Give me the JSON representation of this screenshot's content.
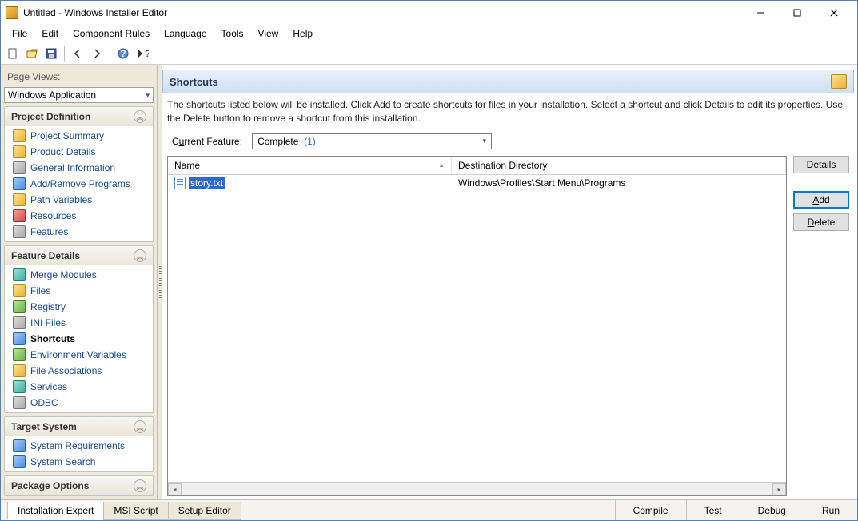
{
  "window": {
    "title": "Untitled - Windows Installer Editor"
  },
  "menu": {
    "file": "File",
    "edit": "Edit",
    "component_rules": "Component Rules",
    "language": "Language",
    "tools": "Tools",
    "view": "View",
    "help": "Help"
  },
  "sidebar": {
    "page_views_label": "Page Views:",
    "page_views_value": "Windows Application",
    "groups": {
      "project_definition": {
        "title": "Project Definition",
        "items": [
          "Project Summary",
          "Product Details",
          "General Information",
          "Add/Remove Programs",
          "Path Variables",
          "Resources",
          "Features"
        ]
      },
      "feature_details": {
        "title": "Feature Details",
        "items": [
          "Merge Modules",
          "Files",
          "Registry",
          "INI Files",
          "Shortcuts",
          "Environment Variables",
          "File Associations",
          "Services",
          "ODBC"
        ]
      },
      "target_system": {
        "title": "Target System",
        "items": [
          "System Requirements",
          "System Search"
        ]
      },
      "package_options": {
        "title": "Package Options"
      }
    }
  },
  "main": {
    "heading": "Shortcuts",
    "description": "The shortcuts listed below will be installed. Click Add to create shortcuts for files in your installation. Select a shortcut and click Details to edit its properties. Use the Delete button to remove a shortcut from this installation.",
    "current_feature_label_pre": "C",
    "current_feature_label_ul": "u",
    "current_feature_label_post": "rrent Feature:",
    "current_feature_value": "Complete",
    "current_feature_tag": "(1)",
    "columns": {
      "name": "Name",
      "dest": "Destination Directory"
    },
    "rows": [
      {
        "name": "story.txt",
        "dest": "Windows\\Profiles\\Start Menu\\Programs"
      }
    ],
    "buttons": {
      "details": "Details",
      "add_ul": "A",
      "add_post": "dd",
      "delete_ul": "D",
      "delete_post": "elete"
    }
  },
  "bottom": {
    "tabs": [
      "Installation Expert",
      "MSI Script",
      "Setup Editor"
    ],
    "actions": [
      "Compile",
      "Test",
      "Debug",
      "Run"
    ]
  }
}
